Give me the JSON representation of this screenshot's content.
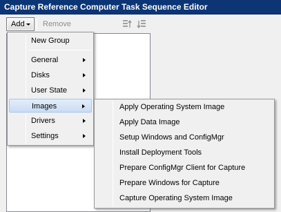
{
  "window": {
    "title": "Capture Reference Computer Task Sequence Editor"
  },
  "toolbar": {
    "add_label": "Add",
    "remove_label": "Remove",
    "icons": [
      "move-up-icon",
      "move-down-icon"
    ]
  },
  "add_menu": {
    "items": [
      {
        "label": "New Group",
        "has_submenu": false
      },
      {
        "label": "General",
        "has_submenu": true
      },
      {
        "label": "Disks",
        "has_submenu": true
      },
      {
        "label": "User State",
        "has_submenu": true
      },
      {
        "label": "Images",
        "has_submenu": true,
        "highlighted": true
      },
      {
        "label": "Drivers",
        "has_submenu": true
      },
      {
        "label": "Settings",
        "has_submenu": true
      }
    ]
  },
  "images_submenu": {
    "items": [
      {
        "label": "Apply Operating System Image"
      },
      {
        "label": "Apply Data Image"
      },
      {
        "label": "Setup Windows and ConfigMgr"
      },
      {
        "label": "Install Deployment Tools"
      },
      {
        "label": "Prepare ConfigMgr Client for Capture"
      },
      {
        "label": "Prepare Windows for Capture"
      },
      {
        "label": "Capture Operating System Image"
      }
    ]
  },
  "colors": {
    "titlebar": "#0b3575",
    "menu_highlight": "#c9dcf5",
    "disabled_text": "#8c8c8c"
  }
}
